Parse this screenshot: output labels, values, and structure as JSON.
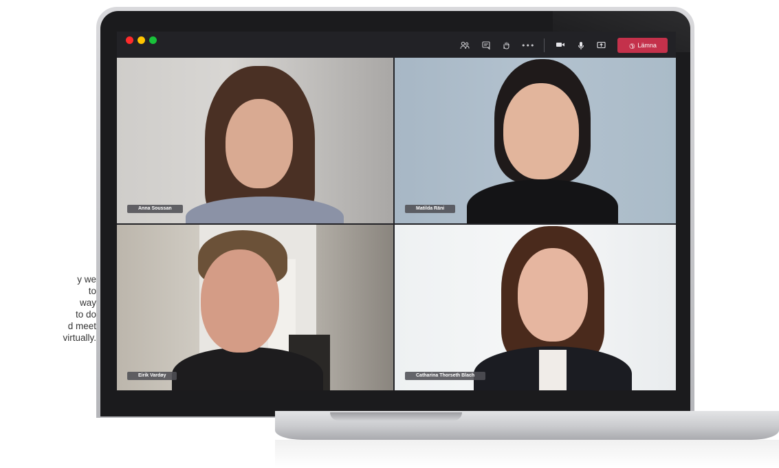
{
  "caption": {
    "lines": [
      "y we",
      "to",
      "way",
      "to do",
      "d meet",
      "virtually."
    ]
  },
  "call": {
    "toolbar": {
      "icons": [
        "participants-icon",
        "chat-icon",
        "raise-hand-icon",
        "more-icon",
        "camera-icon",
        "microphone-icon",
        "share-screen-icon"
      ],
      "leave_label": "Lämna"
    },
    "participants": [
      {
        "name": "Anna Soussan"
      },
      {
        "name": "Matilda Räni"
      },
      {
        "name": "Eirik Vardøy"
      },
      {
        "name": "Catharina Thorseth Blach"
      }
    ]
  },
  "colors": {
    "leave_button": "#c4314b",
    "window_red": "#ff2b2b",
    "window_yellow": "#ffc400",
    "window_green": "#19c23a"
  }
}
